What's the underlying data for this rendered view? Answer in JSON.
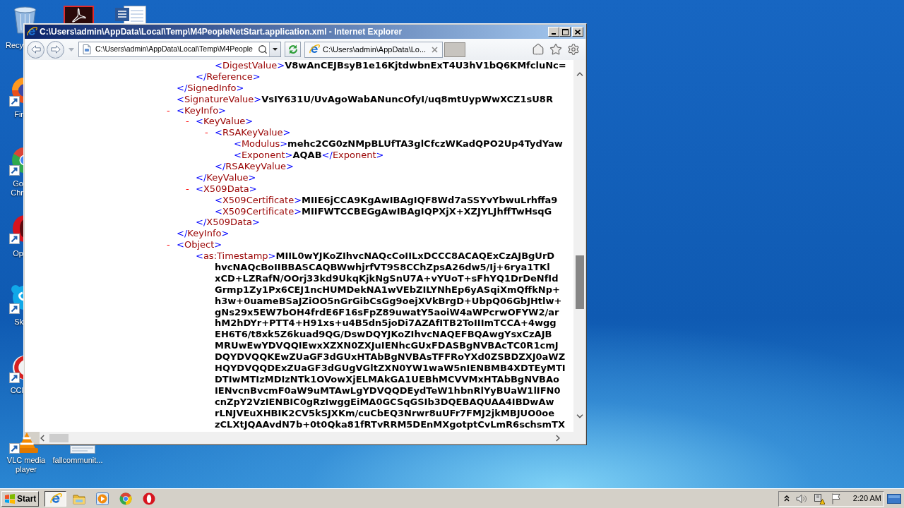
{
  "desktop": {
    "icons": [
      {
        "kind": "recycle-bin",
        "label_lines": [
          "Recy"
        ]
      },
      {
        "kind": "swirl-app"
      },
      {
        "kind": "document"
      },
      {
        "kind": "flame-globe",
        "label_lines": [
          "Fir"
        ]
      },
      {
        "kind": "segmented-circle",
        "label_lines": [
          "Go",
          "Chr"
        ]
      },
      {
        "kind": "ring-logo",
        "label_lines": [
          "Op"
        ]
      },
      {
        "kind": "cloud-logo",
        "label_lines": [
          "Sk"
        ]
      },
      {
        "kind": "c-logo",
        "label_lines": [
          "CCl"
        ]
      },
      {
        "kind": "traffic-cone",
        "label_lines": [
          "VLC media",
          "player"
        ]
      },
      {
        "kind": "file",
        "label_lines": [
          "fallcommunit..."
        ]
      }
    ]
  },
  "window": {
    "title": "C:\\Users\\admin\\AppData\\Local\\Temp\\M4PeopleNetStart.application.xml - Internet Explorer",
    "address": "C:\\Users\\admin\\AppData\\Local\\Temp\\M4People",
    "tabs": [
      {
        "label": "C:\\Users\\admin\\AppData\\Lo...",
        "selected": true
      }
    ],
    "xml": {
      "nodes": [
        {
          "kind": "partial",
          "close": "</SignedInfo>",
          "children": [
            {
              "kind": "partial",
              "close": "</Reference>",
              "children": [
                {
                  "kind": "leaf",
                  "open": "<DigestValue>",
                  "text": "V8wAnCEJBsyB1e16KjtdwbnExT4U3hV1bQ6KMfcluNc="
                }
              ]
            }
          ]
        },
        {
          "kind": "leaf",
          "open": "<SignatureValue>",
          "text": "VsIY631U/UvAgoWabANuncOfyI/uq8mtUypWwXCZ1sU8R"
        },
        {
          "kind": "element",
          "toggle": "-",
          "expanded": true,
          "open": "<KeyInfo>",
          "close": "</KeyInfo>",
          "children": [
            {
              "kind": "element",
              "toggle": "-",
              "expanded": true,
              "open": "<KeyValue>",
              "close": "</KeyValue>",
              "children": [
                {
                  "kind": "element",
                  "toggle": "-",
                  "expanded": true,
                  "open": "<RSAKeyValue>",
                  "close": "</RSAKeyValue>",
                  "children": [
                    {
                      "kind": "leaf",
                      "open": "<Modulus>",
                      "text": "mehc2CG0zNMpBLUfTA3glCfczWKadQPO2Up4TydYaw"
                    },
                    {
                      "kind": "leaf",
                      "open": "<Exponent>",
                      "text": "AQAB",
                      "close": "</Exponent>"
                    }
                  ]
                }
              ]
            },
            {
              "kind": "element",
              "toggle": "-",
              "expanded": true,
              "open": "<X509Data>",
              "close": "</X509Data>",
              "children": [
                {
                  "kind": "leaf",
                  "open": "<X509Certificate>",
                  "text": "MIIE6jCCA9KgAwIBAgIQF8Wd7aSSYvYbwuLrhffa9"
                },
                {
                  "kind": "leaf",
                  "open": "<X509Certificate>",
                  "text": "MIIFWTCCBEGgAwIBAgIQPXjX+XZJYLJhffTwHsqG"
                }
              ]
            }
          ]
        },
        {
          "kind": "element",
          "toggle": "-",
          "expanded": true,
          "open": "<Object>",
          "children": [
            {
              "kind": "leaf",
              "open": "<as:Timestamp>",
              "text_lines": [
                "MIIL0wYJKoZIhvcNAQcCoIILxDCCC8ACAQExCzAJBgUrD",
                "hvcNAQcBoIIBBASCAQBWwhjrfVT9S8CChZpsA26dw5/Ij+6rya1TKl",
                "xCD+LZRafN/OOrj33kd9UkqKjkNgSnU7A+vYUoT+sFhYQ1DrDeNfId",
                "Grmp1Zy1Px6CEJ1ncHUMDekNA1wVEbZILYNhEp6yASqiXmQffkNp+",
                "h3w+0uameBSaJZiOO5nGrGibCsGg9oejXVkBrgD+UbpQ06GbJHtlw+",
                "gNs29x5EW7bOH4frdE6F16sFpZ89uwatY5aoiW4aWPcrwOFYW2/ar",
                "hM2hDYr+PTT4+H91xs+u4B5dn5joDi7AZAfITB2ToIIImTCCA+4wgg",
                "EH6T6/t8xk5Z6kuad9QG/DswDQYJKoZIhvcNAQEFBQAwgYsxCzAJB",
                "MRUwEwYDVQQIEwxXZXN0ZXJuIENhcGUxFDASBgNVBAcTC0R1cmJ",
                "DQYDVQQKEwZUaGF3dGUxHTAbBgNVBAsTFFRoYXd0ZSBDZXJ0aWZ",
                "HQYDVQQDExZUaGF3dGUgVGltZXN0YW1waW5nIENBMB4XDTEyMTI",
                "DTIwMTIzMDIzNTk1OVowXjELMAkGA1UEBhMCVVMxHTAbBgNVBAo",
                "IENvcnBvcmF0aW9uMTAwLgYDVQQDEydTeW1hbnRlYyBUaW1lIFN0",
                "cnZpY2VzIENBIC0gRzIwggEiMA0GCSqGSIb3DQEBAQUAA4IBDwAw",
                "rLNJVEuXHBIK2CV5kSJXKm/cuCbEQ3Nrwr8uUFr7FMJ2jkMBJUO0oe",
                "zCLXtJQAAvdN7b+0t0Qka81fRTvRRM5DEnMXgotptCvLmR6schsmTX"
              ]
            }
          ]
        }
      ]
    }
  },
  "taskbar": {
    "start": "Start",
    "buttons": [
      {
        "kind": "e-logo",
        "selected": true
      },
      {
        "kind": "folder",
        "selected": false
      },
      {
        "kind": "play",
        "selected": false
      },
      {
        "kind": "segmented-circle",
        "selected": false
      },
      {
        "kind": "ring-logo",
        "selected": false
      }
    ],
    "clock": "2:20 AM"
  }
}
